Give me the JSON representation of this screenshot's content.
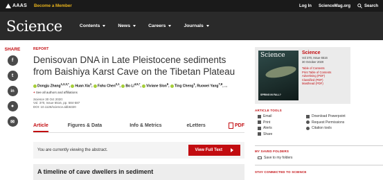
{
  "topbar": {
    "aaas": "AAAS",
    "become_member": "Become a Member",
    "login": "Log In",
    "sciencemag": "ScienceMag.org",
    "search": "Search"
  },
  "nav": {
    "brand": "Science",
    "items": [
      "Contents",
      "News",
      "Careers",
      "Journals"
    ]
  },
  "share": {
    "label": "SHARE",
    "buttons": [
      "f",
      "t",
      "in",
      "rd",
      "mail"
    ]
  },
  "article": {
    "type": "REPORT",
    "title": "Denisovan DNA in Late Pleistocene sediments from Baishiya Karst Cave on the Tibetan Plateau",
    "authors": [
      {
        "name": "Dongju Zhang",
        "sup": "1,2,3,*"
      },
      {
        "name": "Huan Xia",
        "sup": "1"
      },
      {
        "name": "Fahu Chen",
        "sup": "2,1"
      },
      {
        "name": "Bo Li",
        "sup": "4,5,*"
      },
      {
        "name": "Viviane Slon",
        "sup": "6"
      },
      {
        "name": "Ting Cheng",
        "sup": "1"
      },
      {
        "name": "Ruowei Yang",
        "sup": "7,8"
      }
    ],
    "authors_more": "...",
    "see_all": "See all authors and affiliations",
    "journal": "Science",
    "date": "30 Oct 2020:",
    "volume": "Vol. 370, Issue 6516, pp. 584-587",
    "doi": "DOI: 10.1126/science.abb6320"
  },
  "tabs": {
    "items": [
      "Article",
      "Figures & Data",
      "Info & Metrics",
      "eLetters"
    ],
    "pdf": "PDF"
  },
  "abstract_bar": {
    "text": "You are currently viewing the abstract.",
    "button": "View Full Text"
  },
  "summary": {
    "title": "A timeline of cave dwellers in sediment"
  },
  "issue": {
    "cover_title": "Science",
    "cover_text": "SPRING IN FALL?",
    "name": "Science",
    "vol": "Vol 370, Issue 6516",
    "date": "30 October 2020",
    "links": [
      "Table of Contents",
      "Print Table of Contents",
      "Advertising (PDF)",
      "Classified (PDF)",
      "Masthead (PDF)"
    ]
  },
  "tools": {
    "title": "ARTICLE TOOLS",
    "left": [
      "Email",
      "Print",
      "Alerts",
      "Share"
    ],
    "right": [
      "Download Powerpoint",
      "Request Permissions",
      "Citation tools"
    ]
  },
  "folders": {
    "title": "MY SAVED FOLDERS",
    "save": "Save to my folders"
  },
  "connected": {
    "title": "STAY CONNECTED TO SCIENCE"
  },
  "colors": {
    "accent": "#c20c10",
    "gold": "#e8b31c",
    "nav_bg": "#2a2a2a",
    "top_bg": "#1a1a1a"
  }
}
